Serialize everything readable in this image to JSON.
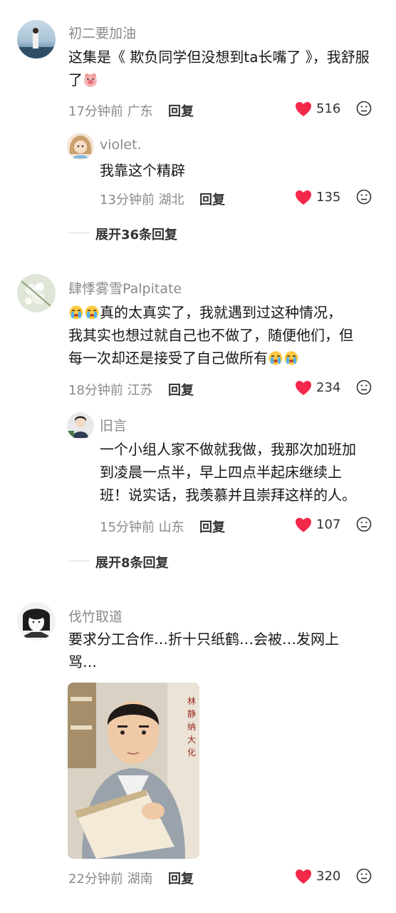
{
  "comments": [
    {
      "user": "初二要加油",
      "text": "这集是《 欺负同学但没想到ta长嘴了 》，我舒服了",
      "time": "17分钟前",
      "region": "广东",
      "reply_label": "回复",
      "likes": "516",
      "emoji_end": "pig-face-emoji",
      "replies": [
        {
          "user": "violet.",
          "text": "我靠这个精辟",
          "time": "13分钟前",
          "region": "湖北",
          "reply_label": "回复",
          "likes": "135"
        }
      ],
      "expand_label": "展开36条回复"
    },
    {
      "user": "肆悸雾雪Palpitate",
      "text_line1": "真的太真实了，我就遇到过这种情况，",
      "text_line2": "我其实也想过就自己也不做了，随便他们，但",
      "text_line3": "每一次却还是接受了自己做所有",
      "time": "18分钟前",
      "region": "江苏",
      "reply_label": "回复",
      "likes": "234",
      "emoji": "crying-emoji",
      "replies": [
        {
          "user": "旧言",
          "text_line1": "一个小组人家不做就我做，我那次加班加",
          "text_line2": "到凌晨一点半，早上四点半起床继续上",
          "text_line3": "班！说实话，我羡慕并且崇拜这样的人。",
          "time": "15分钟前",
          "region": "山东",
          "reply_label": "回复",
          "likes": "107"
        }
      ],
      "expand_label": "展开8条回复"
    },
    {
      "user": "伐竹取道",
      "text_line1": "要求分工合作…折十只纸鹤…会被…发网上",
      "text_line2": "骂…",
      "time": "22分钟前",
      "region": "湖南",
      "reply_label": "回复",
      "likes": "320",
      "attachment": "photo-of-man-writing-in-notebook"
    }
  ],
  "colors": {
    "heart": "#f4284a",
    "meta": "#8a8a8a"
  }
}
